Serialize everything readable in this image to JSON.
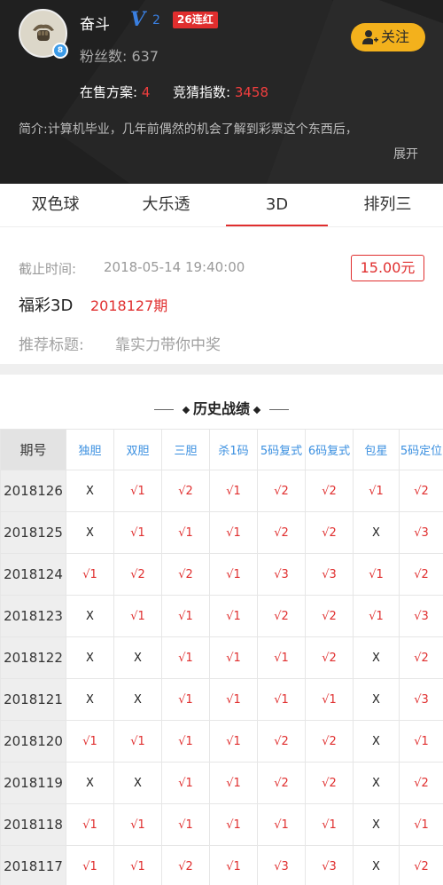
{
  "profile": {
    "name": "奋斗",
    "vip_v": "V",
    "vip_level": "2",
    "streak": "26连红",
    "fans": "粉丝数: 637",
    "follow_label": "关注",
    "avatar_badge": "8",
    "plans_label": "在售方案: ",
    "plans_count": "4",
    "index_label": "竞猜指数: ",
    "index_value": "3458",
    "intro": "简介:计算机毕业，几年前偶然的机会了解到彩票这个东西后，",
    "expand": "展开"
  },
  "tabs": [
    {
      "label": "双色球"
    },
    {
      "label": "大乐透"
    },
    {
      "label": "3D"
    },
    {
      "label": "排列三"
    }
  ],
  "active_tab": "3D",
  "plan": {
    "deadline_label": "截止时间:",
    "deadline_value": "2018-05-14 19:40:00",
    "price": "15.00元",
    "lottery_name": "福彩3D",
    "issue": "2018127期",
    "rec_label": "推荐标题:",
    "rec_title": "靠实力带你中奖"
  },
  "history": {
    "title": "历史战绩",
    "headers": [
      "期号",
      "独胆",
      "双胆",
      "三胆",
      "杀1码",
      "5码复式",
      "6码复式",
      "包星",
      "5码定位"
    ],
    "rows": [
      [
        "2018126",
        "X",
        "√1",
        "√2",
        "√1",
        "√2",
        "√2",
        "√1",
        "√2"
      ],
      [
        "2018125",
        "X",
        "√1",
        "√1",
        "√1",
        "√2",
        "√2",
        "X",
        "√3"
      ],
      [
        "2018124",
        "√1",
        "√2",
        "√2",
        "√1",
        "√3",
        "√3",
        "√1",
        "√2"
      ],
      [
        "2018123",
        "X",
        "√1",
        "√1",
        "√1",
        "√2",
        "√2",
        "√1",
        "√3"
      ],
      [
        "2018122",
        "X",
        "X",
        "√1",
        "√1",
        "√1",
        "√2",
        "X",
        "√2"
      ],
      [
        "2018121",
        "X",
        "X",
        "√1",
        "√1",
        "√1",
        "√1",
        "X",
        "√3"
      ],
      [
        "2018120",
        "√1",
        "√1",
        "√1",
        "√1",
        "√2",
        "√2",
        "X",
        "√1"
      ],
      [
        "2018119",
        "X",
        "X",
        "√1",
        "√1",
        "√2",
        "√2",
        "X",
        "√2"
      ],
      [
        "2018118",
        "√1",
        "√1",
        "√1",
        "√1",
        "√1",
        "√1",
        "X",
        "√1"
      ],
      [
        "2018117",
        "√1",
        "√1",
        "√2",
        "√1",
        "√3",
        "√3",
        "X",
        "√2"
      ]
    ]
  },
  "colors": {
    "accent_red": "#e02e2e",
    "follow_yellow": "#f3b11c",
    "vip_blue": "#3a7fe0",
    "header_bg": "#202020",
    "table_header_blue": "#3a8fe0"
  },
  "icons": {
    "avatar": "fist-avatar",
    "follow": "person-plus-icon",
    "badge": "level-badge-icon"
  }
}
